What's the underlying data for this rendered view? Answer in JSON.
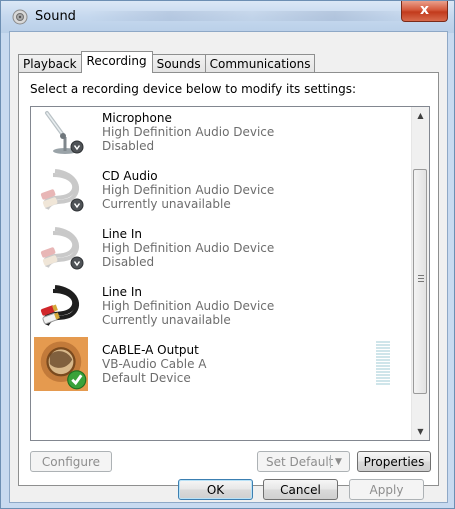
{
  "window": {
    "title": "Sound",
    "close_label": "x"
  },
  "tabs": [
    "Playback",
    "Recording",
    "Sounds",
    "Communications"
  ],
  "active_tab": "Recording",
  "instruction": "Select a recording device below to modify its settings:",
  "devices": [
    {
      "name": "Microphone",
      "driver": "High Definition Audio Device",
      "status": "Disabled",
      "icon": "microphone-icon",
      "badge": "down-arrow-badge"
    },
    {
      "name": "CD Audio",
      "driver": "High Definition Audio Device",
      "status": "Currently unavailable",
      "icon": "rca-cable-icon",
      "badge": "down-arrow-badge"
    },
    {
      "name": "Line In",
      "driver": "High Definition Audio Device",
      "status": "Disabled",
      "icon": "rca-cable-icon",
      "badge": "down-arrow-badge"
    },
    {
      "name": "Line In",
      "driver": "High Definition Audio Device",
      "status": "Currently unavailable",
      "icon": "rca-cable-icon",
      "badge": "none"
    },
    {
      "name": "CABLE-A Output",
      "driver": "VB-Audio Cable A",
      "status": "Default Device",
      "icon": "cable-a-icon",
      "badge": "green-check-badge"
    }
  ],
  "buttons": {
    "configure": "Configure",
    "set_default": "Set Default",
    "properties": "Properties",
    "ok": "OK",
    "cancel": "Cancel",
    "apply": "Apply"
  },
  "colors": {
    "accent": "#3c7fb1",
    "check_green": "#3aa23a",
    "close_red": "#c23a1c"
  }
}
